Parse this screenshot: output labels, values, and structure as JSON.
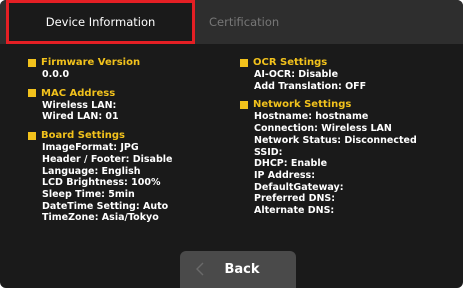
{
  "tabs": {
    "device_info": "Device Information",
    "certification": "Certification"
  },
  "left": {
    "firmware": {
      "title": "Firmware Version",
      "lines": [
        "0.0.0"
      ]
    },
    "mac": {
      "title": "MAC Address",
      "lines": [
        "Wireless LAN:",
        "Wired LAN: 01"
      ]
    },
    "board": {
      "title": "Board Settings",
      "lines": [
        "ImageFormat: JPG",
        "Header / Footer: Disable",
        "Language: English",
        "LCD Brightness: 100%",
        "Sleep Time: 5min",
        "DateTime Setting: Auto",
        "TimeZone: Asia/Tokyo"
      ]
    }
  },
  "right": {
    "ocr": {
      "title": "OCR Settings",
      "lines": [
        "AI-OCR: Disable",
        "Add Translation: OFF"
      ]
    },
    "network": {
      "title": "Network Settings",
      "lines": [
        "Hostname: hostname",
        "Connection: Wireless LAN",
        "Network Status: Disconnected",
        "SSID:",
        "DHCP: Enable",
        "IP Address:",
        "DefaultGateway:",
        "Preferred DNS:",
        "Alternate DNS:"
      ]
    }
  },
  "footer": {
    "back_label": "Back"
  },
  "colors": {
    "accent": "#f2c21c",
    "highlight": "#e41f24",
    "background": "#1a1a1a"
  },
  "icons": {
    "back": "chevron-left-icon",
    "section": "square-bullet-icon"
  }
}
